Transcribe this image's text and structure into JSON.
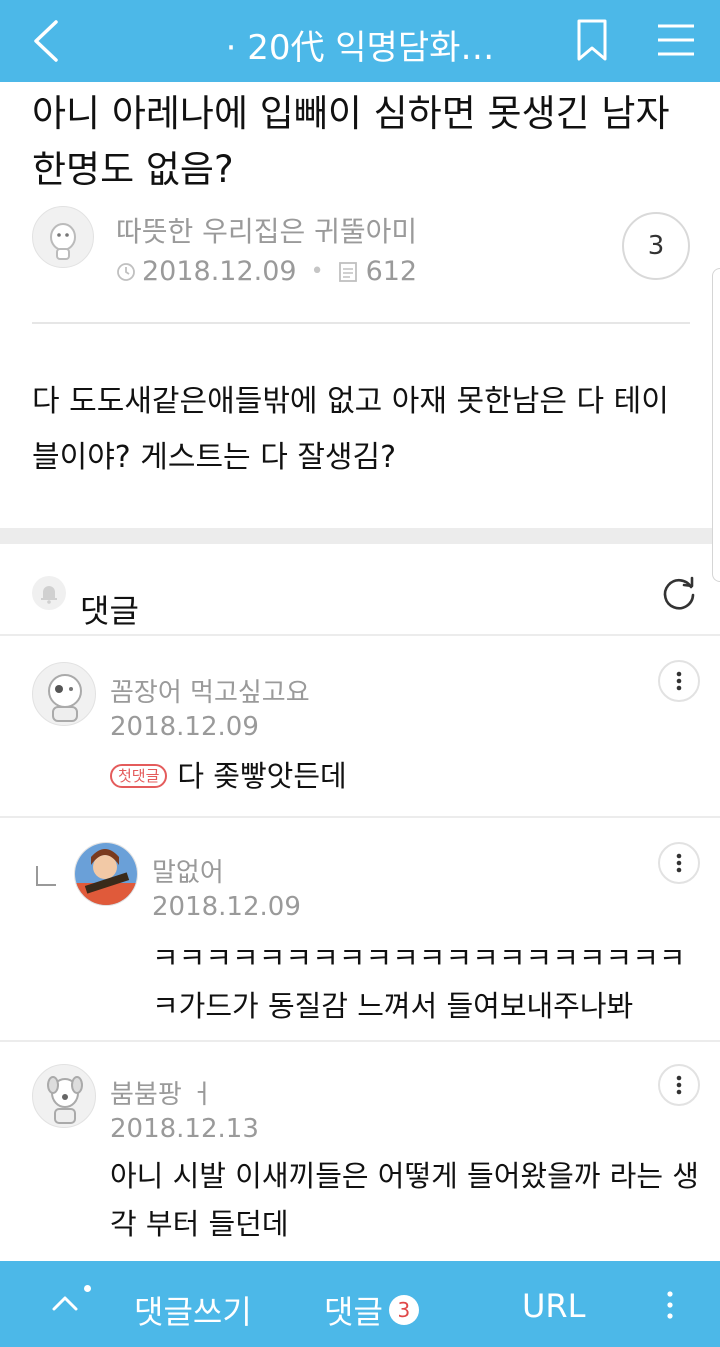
{
  "app": {
    "title": "· 20代 익명담화…",
    "accent_color": "#4cb8e8"
  },
  "post": {
    "title": "아니 아레나에 입빼이 심하면 못생긴 남자 한명도 없음?",
    "author": "따뜻한 우리집은 귀뚤아미",
    "date": "2018.12.09",
    "views": "612",
    "comment_count": "3",
    "body": "다 도도새같은애들밖에 없고 아재 못한남은 다 테이블이야? 게스트는 다 잘생김?"
  },
  "comments_header": {
    "label": "댓글"
  },
  "comments": [
    {
      "name": "꼼장어 먹고싶고요",
      "date": "2018.12.09",
      "badge": "첫댓글",
      "text": "다 좆빻앗든데",
      "is_reply": false
    },
    {
      "name": "말없어",
      "date": "2018.12.09",
      "text": "ㅋㅋㅋㅋㅋㅋㅋㅋㅋㅋㅋㅋㅋㅋㅋㅋㅋㅋㅋㅋㅋ가드가 동질감 느껴서 들여보내주나봐",
      "is_reply": true
    },
    {
      "name": "붐붐팡 ㅓ",
      "date": "2018.12.13",
      "text": "아니 시발 이새끼들은 어떻게 들어왔을까 라는 생각 부터 들던데",
      "is_reply": false
    }
  ],
  "bottom_bar": {
    "write_label": "댓글쓰기",
    "comments_label": "댓글",
    "comments_count": "3",
    "url_label": "URL"
  },
  "icons": [
    "back-icon",
    "bookmark-icon",
    "menu-icon",
    "clock-icon",
    "document-icon",
    "bell-icon",
    "refresh-icon",
    "more-icon",
    "up-icon"
  ]
}
